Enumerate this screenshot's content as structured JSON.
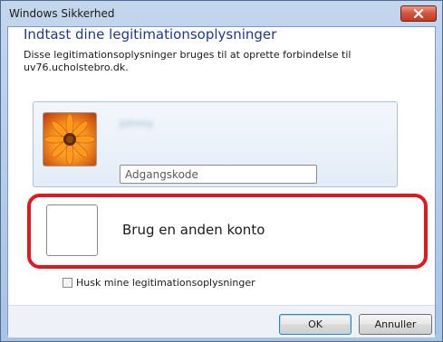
{
  "window": {
    "title": "Windows Sikkerhed"
  },
  "dialog": {
    "heading": "Indtast dine legitimationsoplysninger",
    "description": "Disse legitimationsoplysninger bruges til at oprette forbindelse til uv76.ucholstebro.dk."
  },
  "credential": {
    "username": "johnny",
    "password_placeholder": "Adgangskode",
    "password_value": ""
  },
  "other_account": {
    "label": "Brug en anden konto"
  },
  "remember": {
    "label": "Husk mine legitimationsoplysninger",
    "checked": false
  },
  "buttons": {
    "ok_label": "OK",
    "cancel_label": "Annuller"
  },
  "colors": {
    "highlight": "#e0191f",
    "heading": "#1e3b8a"
  }
}
